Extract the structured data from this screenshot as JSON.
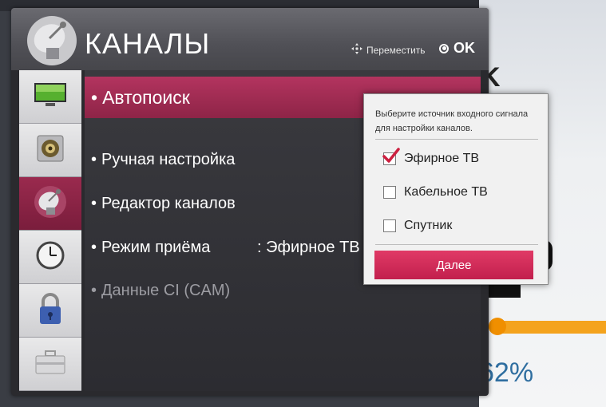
{
  "header": {
    "title": "КАНАЛЫ",
    "move_hint": "Переместить",
    "ok_hint": "OK"
  },
  "background": {
    "percent": "62%"
  },
  "sidebar": {
    "items": [
      {
        "icon": "tv-picture-icon"
      },
      {
        "icon": "speaker-icon"
      },
      {
        "icon": "satellite-dish-icon",
        "active": true
      },
      {
        "icon": "clock-icon"
      },
      {
        "icon": "lock-icon"
      },
      {
        "icon": "toolbox-icon"
      }
    ]
  },
  "menu": {
    "items": [
      {
        "label": "Автопоиск",
        "selected": true
      },
      {
        "label": "Ручная настройка"
      },
      {
        "label": "Редактор каналов"
      },
      {
        "label": "Режим приёма",
        "value": ": Эфирное ТВ"
      },
      {
        "label": "Данные CI (CAM)",
        "disabled": true
      }
    ]
  },
  "popup": {
    "description": "Выберите источник входного сигнала для настройки каналов.",
    "options": [
      {
        "label": "Эфирное ТВ",
        "checked": true
      },
      {
        "label": "Кабельное ТВ",
        "checked": false
      },
      {
        "label": "Спутник",
        "checked": false
      }
    ],
    "next_label": "Далее"
  },
  "colors": {
    "accent": "#b3345f",
    "button": "#d42a58"
  }
}
